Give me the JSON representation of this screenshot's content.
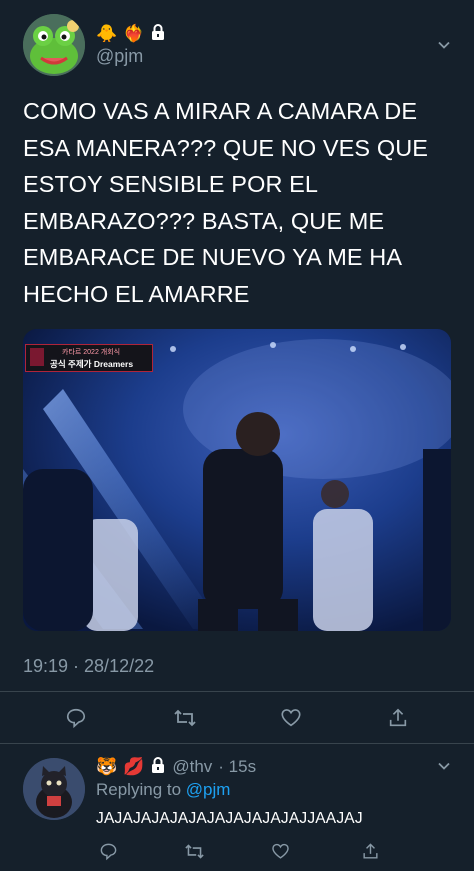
{
  "colors": {
    "background": "#15202b",
    "secondary_text": "#8899a6",
    "link": "#1da1f2",
    "divider": "#38444d"
  },
  "tweet": {
    "author": {
      "badges": [
        "🐥",
        "❤️‍🔥"
      ],
      "lock_icon": "lock-icon",
      "handle": "@pjm"
    },
    "text_lines": [
      "COMO VAS A MIRAR A CAMARA DE",
      "ESA MANERA??? QUE NO VES QUE",
      "ESTOY SENSIBLE POR EL",
      "EMBARAZO??? BASTA, QUE ME",
      "EMBARACE DE NUEVO YA ME HA",
      "HECHO EL AMARRE"
    ],
    "media": {
      "broadcast_line1": "카타르 2022  개회식",
      "broadcast_line2": "공식 주제가 Dreamers"
    },
    "timestamp": "19:19 · 28/12/22",
    "actions": [
      "reply-icon",
      "retweet-icon",
      "like-icon",
      "share-icon"
    ]
  },
  "reply": {
    "badges": [
      "🐯",
      "💋"
    ],
    "lock_icon": "lock-icon",
    "handle": "@thv",
    "time": "· 15s",
    "replying_label": "Replying to",
    "replying_handle": "@pjm",
    "text": "JAJAJAJAJAJAJAJAJAJAJAJJAAJAJ",
    "actions": [
      "reply-icon",
      "retweet-icon",
      "like-icon",
      "share-icon"
    ]
  }
}
